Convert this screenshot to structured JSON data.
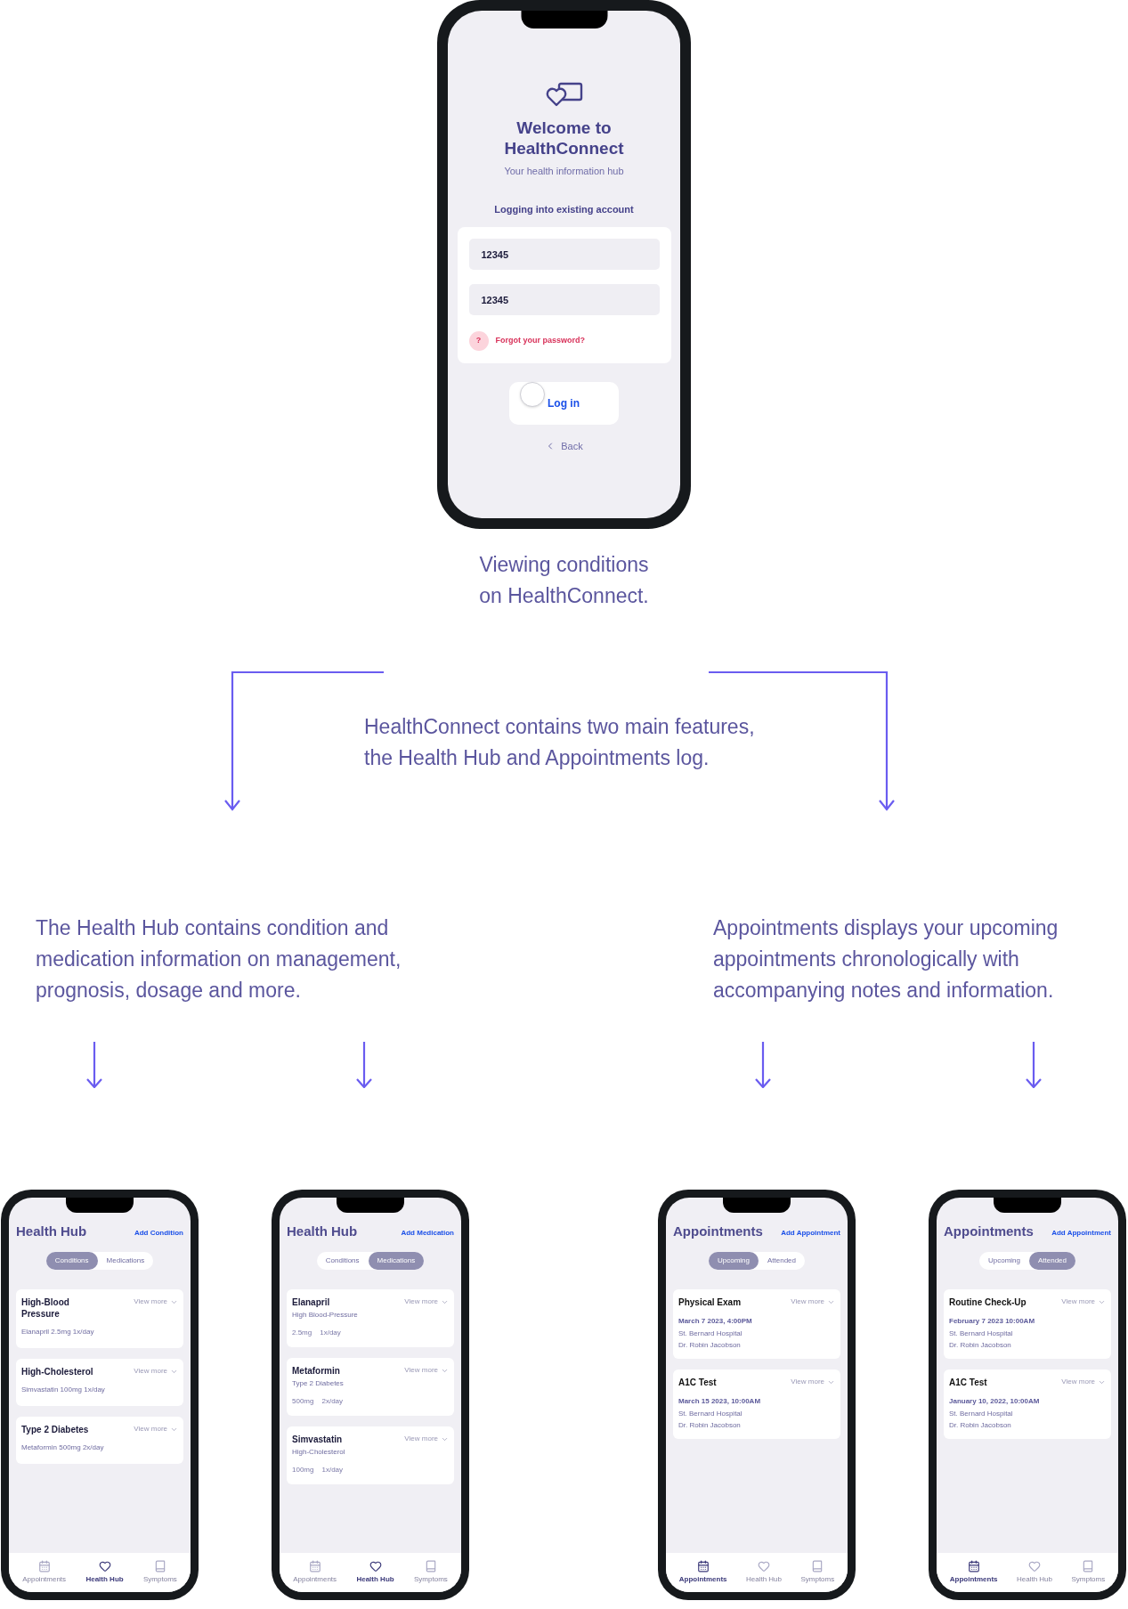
{
  "login_screen": {
    "title_lines": [
      "Welcome to",
      "HealthConnect"
    ],
    "subtitle": "Your health information hub",
    "section_label": "Logging into existing account",
    "fields": [
      {
        "value": "12345"
      },
      {
        "value": "12345"
      }
    ],
    "help_badge": "?",
    "forgot_link": "Forgot your password?",
    "login_button": "Log in",
    "back_link": "Back"
  },
  "caption_lines": [
    "Viewing conditions",
    "on HealthConnect."
  ],
  "features_lines": [
    "HealthConnect contains two main features,",
    "the Health Hub and Appointments log."
  ],
  "health_hub_lines": [
    "The Health Hub contains condition and",
    "medication information on management,",
    "prognosis, dosage and more."
  ],
  "appointments_lines": [
    "Appointments displays your upcoming",
    "appointments chronologically with",
    "accompanying notes and information."
  ],
  "screens": [
    {
      "title": "Health Hub",
      "action": "Add Condition",
      "segments": [
        {
          "label": "Conditions",
          "selected": true
        },
        {
          "label": "Medications",
          "selected": false
        }
      ],
      "cards": [
        {
          "kind": "condition",
          "name": "High-Blood Pressure",
          "view_more": "View more",
          "detail": "Elanapril 2.5mg 1x/day"
        },
        {
          "kind": "condition",
          "name": "High-Cholesterol",
          "view_more": "View more",
          "detail": "Simvastatin 100mg 1x/day"
        },
        {
          "kind": "condition",
          "name": "Type 2 Diabetes",
          "view_more": "View more",
          "detail": "Metaformin 500mg 2x/day"
        }
      ],
      "nav": [
        {
          "label": "Appointments",
          "selected": false
        },
        {
          "label": "Health Hub",
          "selected": true
        },
        {
          "label": "Symptoms",
          "selected": false
        }
      ]
    },
    {
      "title": "Health Hub",
      "action": "Add Medication",
      "segments": [
        {
          "label": "Conditions",
          "selected": false
        },
        {
          "label": "Medications",
          "selected": true
        }
      ],
      "cards": [
        {
          "kind": "medication",
          "name": "Elanapril",
          "view_more": "View more",
          "condition": "High Blood-Pressure",
          "dose": "2.5mg",
          "frequency": "1x/day"
        },
        {
          "kind": "medication",
          "name": "Metaformin",
          "view_more": "View more",
          "condition": "Type 2 Diabetes",
          "dose": "500mg",
          "frequency": "2x/day"
        },
        {
          "kind": "medication",
          "name": "Simvastatin",
          "view_more": "View more",
          "condition": "High-Cholesterol",
          "dose": "100mg",
          "frequency": "1x/day"
        }
      ],
      "nav": [
        {
          "label": "Appointments",
          "selected": false
        },
        {
          "label": "Health Hub",
          "selected": true
        },
        {
          "label": "Symptoms",
          "selected": false
        }
      ]
    },
    {
      "title": "Appointments",
      "action": "Add Appointment",
      "segments": [
        {
          "label": "Upcoming",
          "selected": true
        },
        {
          "label": "Attended",
          "selected": false
        }
      ],
      "cards": [
        {
          "kind": "appointment",
          "name": "Physical Exam",
          "view_more": "View more",
          "datetime": "March 7 2023, 4:00PM",
          "place": "St. Bernard Hospital",
          "doctor": "Dr. Robin Jacobson"
        },
        {
          "kind": "appointment",
          "name": "A1C Test",
          "view_more": "View more",
          "datetime": "March 15 2023, 10:00AM",
          "place": "St. Bernard Hospital",
          "doctor": "Dr. Robin Jacobson"
        }
      ],
      "nav": [
        {
          "label": "Appointments",
          "selected": true
        },
        {
          "label": "Health Hub",
          "selected": false
        },
        {
          "label": "Symptoms",
          "selected": false
        }
      ]
    },
    {
      "title": "Appointments",
      "action": "Add Appointment",
      "segments": [
        {
          "label": "Upcoming",
          "selected": false
        },
        {
          "label": "Attended",
          "selected": true
        }
      ],
      "cards": [
        {
          "kind": "appointment",
          "name": "Routine Check-Up",
          "view_more": "View more",
          "datetime": "February 7 2023 10:00AM",
          "place": "St. Bernard Hospital",
          "doctor": "Dr. Robin Jacobson"
        },
        {
          "kind": "appointment",
          "name": "A1C Test",
          "view_more": "View more",
          "datetime": "January 10, 2022, 10:00AM",
          "place": "St. Bernard Hospital",
          "doctor": "Dr. Robin Jacobson"
        }
      ],
      "nav": [
        {
          "label": "Appointments",
          "selected": true
        },
        {
          "label": "Health Hub",
          "selected": false
        },
        {
          "label": "Symptoms",
          "selected": false
        }
      ]
    }
  ]
}
